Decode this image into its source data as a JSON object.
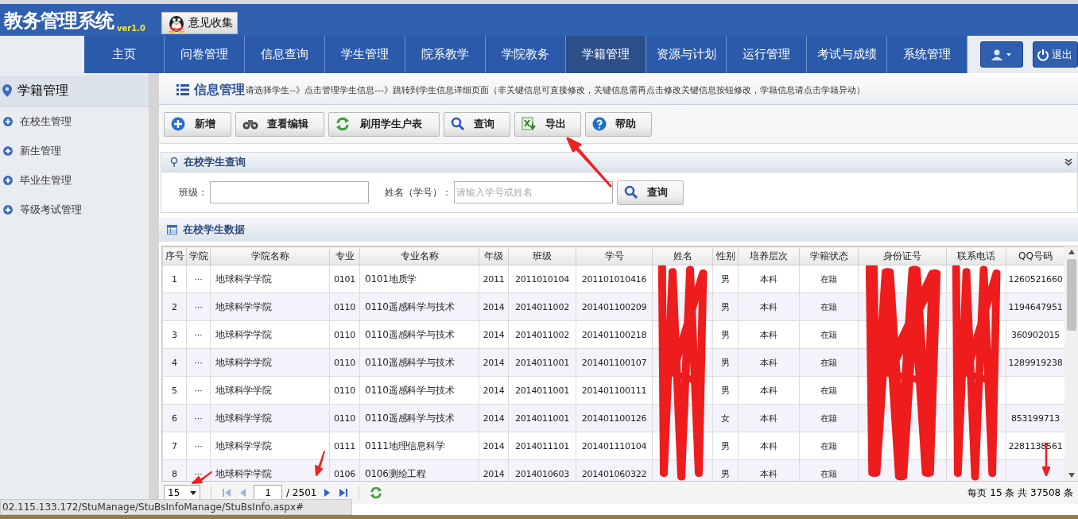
{
  "app": {
    "title": "教务管理系统",
    "version": "ver1.0",
    "feedback_button": "意见收集"
  },
  "nav": [
    {
      "label": "主页",
      "selected": false
    },
    {
      "label": "问卷管理",
      "selected": false
    },
    {
      "label": "信息查询",
      "selected": false
    },
    {
      "label": "学生管理",
      "selected": false
    },
    {
      "label": "院系教学",
      "selected": false
    },
    {
      "label": "学院教务",
      "selected": false
    },
    {
      "label": "学籍管理",
      "selected": true
    },
    {
      "label": "资源与计划",
      "selected": false
    },
    {
      "label": "运行管理",
      "selected": false
    },
    {
      "label": "考试与成绩",
      "selected": false
    },
    {
      "label": "系统管理",
      "selected": false
    }
  ],
  "logout_button": "退出",
  "sidebar": {
    "title": "学籍管理",
    "items": [
      "在校生管理",
      "新生管理",
      "毕业生管理",
      "等级考试管理"
    ]
  },
  "breadcrumb": {
    "title": "信息管理",
    "hint": "请选择学生--》点击管理学生信息---》跳转到学生信息详细页面（非关键信息可直接修改，关键信息需再点击修改关键信息按钮修改，学籍信息请点击学籍异动）"
  },
  "toolbar": [
    {
      "label": "新增",
      "kind": "add"
    },
    {
      "label": "查看编辑",
      "kind": "view"
    },
    {
      "label": "刷用学生户表",
      "kind": "refresh"
    },
    {
      "label": "查询",
      "kind": "search"
    },
    {
      "label": "导出",
      "kind": "export"
    },
    {
      "label": "帮助",
      "kind": "help"
    }
  ],
  "query_panel": {
    "title": "在校学生查询",
    "fields": [
      {
        "label": "班级："
      },
      {
        "label": "姓名（学号）：",
        "placeholder": "请输入学号或姓名"
      }
    ],
    "button": "查询"
  },
  "table": {
    "title": "在校学生数据",
    "columns": [
      {
        "label": "序号"
      },
      {
        "label": "学院"
      },
      {
        "label": "学院名称"
      },
      {
        "label": "专业"
      },
      {
        "label": "专业名称"
      },
      {
        "label": "年级"
      },
      {
        "label": "班级"
      },
      {
        "label": "学号"
      },
      {
        "label": "姓名",
        "redacted": true
      },
      {
        "label": "性别"
      },
      {
        "label": "培养层次"
      },
      {
        "label": "学籍状态"
      },
      {
        "label": "身份证号",
        "redacted": true
      },
      {
        "label": "联系电话",
        "redacted": true
      },
      {
        "label": "QQ号码"
      }
    ],
    "rows": [
      [
        "1",
        "···",
        "地球科学学院",
        "0101",
        "0101地质学",
        "2011",
        "2011010104",
        "201101010416",
        null,
        "男",
        "本科",
        "在籍",
        null,
        null,
        "1260521660"
      ],
      [
        "2",
        "···",
        "地球科学学院",
        "0110",
        "0110遥感科学与技术",
        "2014",
        "2014011002",
        "201401100209",
        null,
        "男",
        "本科",
        "在籍",
        null,
        null,
        "1194647951"
      ],
      [
        "3",
        "···",
        "地球科学学院",
        "0110",
        "0110遥感科学与技术",
        "2014",
        "2014011002",
        "201401100218",
        null,
        "男",
        "本科",
        "在籍",
        null,
        null,
        "360902015"
      ],
      [
        "4",
        "···",
        "地球科学学院",
        "0110",
        "0110遥感科学与技术",
        "2014",
        "2014011001",
        "201401100107",
        null,
        "男",
        "本科",
        "在籍",
        null,
        null,
        "1289919238"
      ],
      [
        "5",
        "···",
        "地球科学学院",
        "0110",
        "0110遥感科学与技术",
        "2014",
        "2014011001",
        "201401100111",
        null,
        "男",
        "本科",
        "在籍",
        null,
        null,
        null
      ],
      [
        "6",
        "···",
        "地球科学学院",
        "0110",
        "0110遥感科学与技术",
        "2014",
        "2014011001",
        "201401100126",
        null,
        "女",
        "本科",
        "在籍",
        null,
        null,
        "853199713"
      ],
      [
        "7",
        "···",
        "地球科学学院",
        "0111",
        "0111地理信息科学",
        "2014",
        "2014011101",
        "201401110104",
        null,
        "男",
        "本科",
        "在籍",
        null,
        null,
        "2281138561"
      ],
      [
        "8",
        "···",
        "地球科学学院",
        "0106",
        "0106测绘工程",
        "2014",
        "2014010603",
        "201401060322",
        null,
        "男",
        "本科",
        "在籍",
        null,
        null,
        null
      ]
    ]
  },
  "pager": {
    "page_size": "15",
    "page": "1",
    "total_pages": "/ 2501",
    "summary": "每页 15 条 共 37508 条"
  },
  "status_bar": {
    "url": "02.115.133.172/StuManage/StuBsInfoManage/StuBsInfo.aspx#"
  }
}
